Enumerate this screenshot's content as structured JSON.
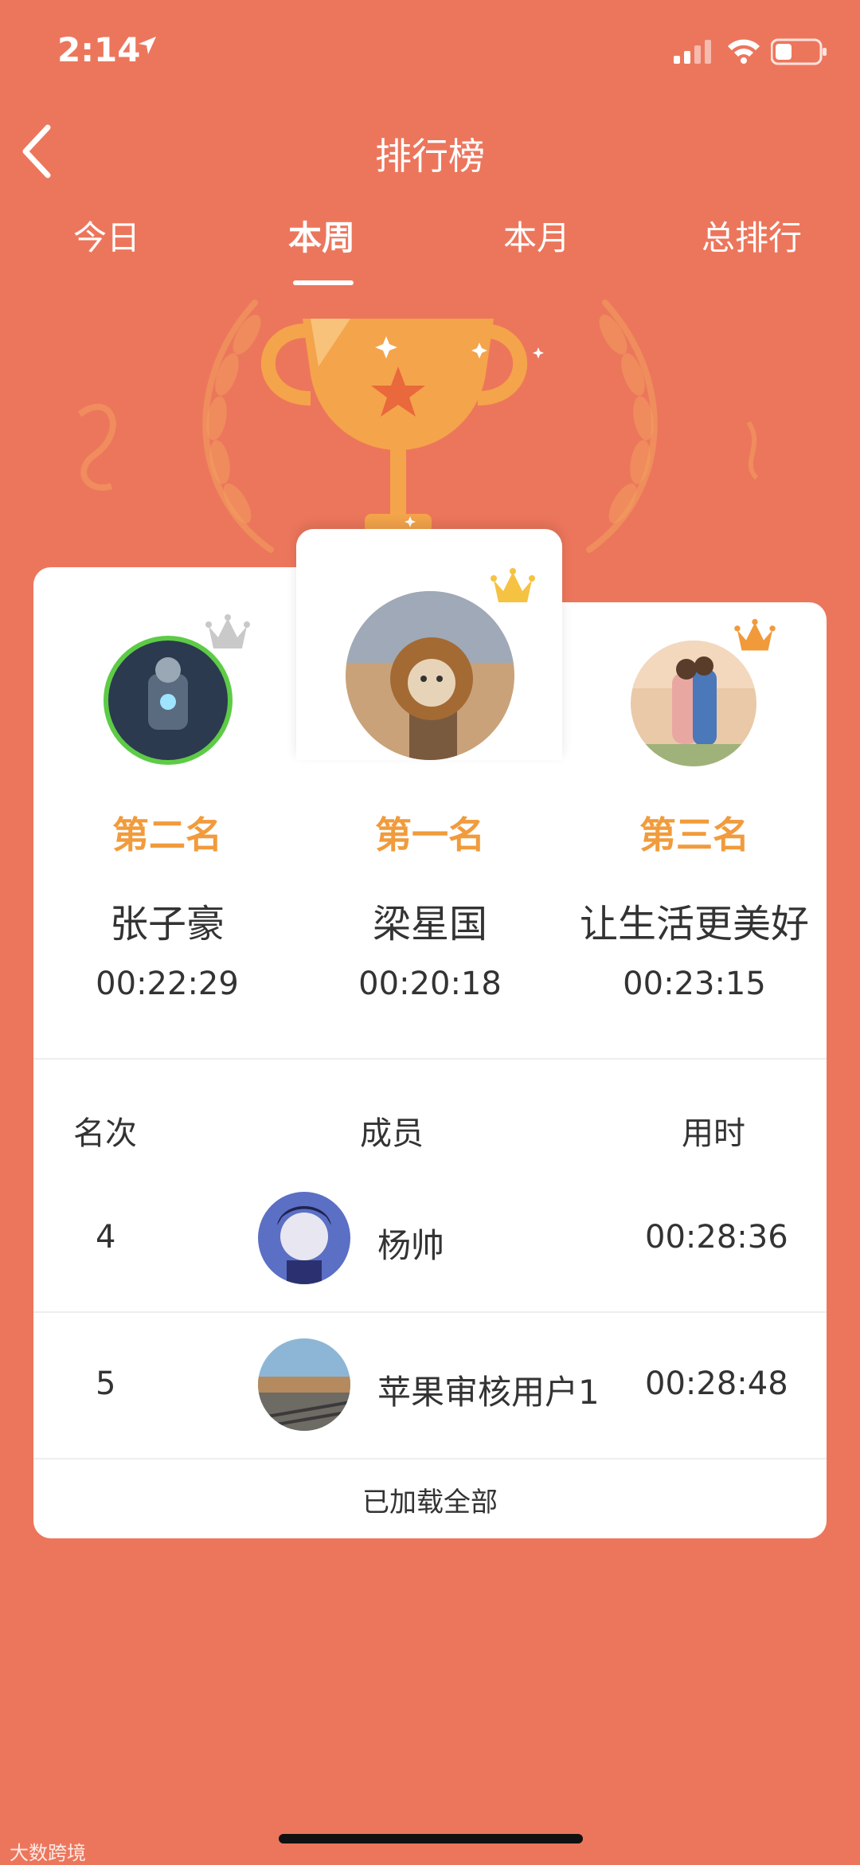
{
  "status_bar": {
    "time": "2:14"
  },
  "header": {
    "title": "排行榜"
  },
  "tabs": [
    {
      "label": "今日",
      "active": false
    },
    {
      "label": "本周",
      "active": true
    },
    {
      "label": "本月",
      "active": false
    },
    {
      "label": "总排行",
      "active": false
    }
  ],
  "podium": [
    {
      "place_label": "第二名",
      "name": "张子豪",
      "time": "00:22:29",
      "crown": "silver-crown-icon"
    },
    {
      "place_label": "第一名",
      "name": "梁星国",
      "time": "00:20:18",
      "crown": "gold-crown-icon"
    },
    {
      "place_label": "第三名",
      "name": "让生活更美好",
      "time": "00:23:15",
      "crown": "bronze-crown-icon"
    }
  ],
  "table": {
    "headers": {
      "rank": "名次",
      "member": "成员",
      "time": "用时"
    },
    "rows": [
      {
        "rank": "4",
        "name": "杨帅",
        "time": "00:28:36"
      },
      {
        "rank": "5",
        "name": "苹果审核用户1",
        "time": "00:28:48"
      }
    ],
    "footer": "已加载全部"
  },
  "watermark": "大数跨境",
  "colors": {
    "background": "#EC765C",
    "rank_label": "#F19B3C",
    "gold": "#F5C242",
    "silver": "#C9C9C9",
    "bronze": "#F09A3A"
  }
}
